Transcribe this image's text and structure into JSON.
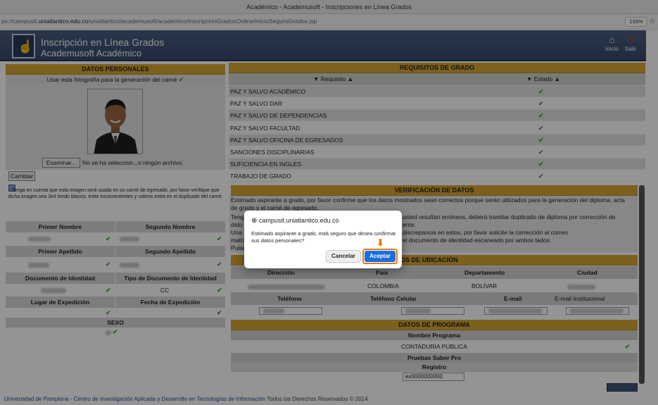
{
  "browser": {
    "window_title": "Académico - Academusoft - Inscripciones en Línea Grados",
    "url_prefix": "ps://campusit.",
    "url_domain": "uniatlantico.edu.co",
    "url_path": "/uniatlantico/academusoft/academico/inscripcionGradosOnline/inicioSeguroGrados.jsp",
    "zoom": "133%"
  },
  "header": {
    "title": "Inscripción en Línea Grados",
    "subtitle": "Academusoft Académico",
    "nav_home": "Inicio",
    "nav_exit": "Salir"
  },
  "personal": {
    "section_title": "DATOS PERSONALES",
    "photo_note": "Usar esta fotografía para la generación del carné",
    "browse_label": "Examinar...",
    "file_status": "No se ha seleccion...o ningún archivo.",
    "change_label": "Cambiar",
    "notice": "Tenga en cuenta que esta imagen será usada en su carné de egresado, por favor verifique que dicha imagen sea 3x4 fondo blanco, evite inconvenientes y cobros extra en el duplicado del carné.",
    "first_name_label": "Primer Nombre",
    "second_name_label": "Segundo Nombre",
    "first_surname_label": "Primer Apellido",
    "second_surname_label": "Segundo Apellido",
    "id_label": "Documento de Identidad",
    "id_type_label": "Tipo de Documento de Identidad",
    "id_type_value": "CC",
    "issue_place_label": "Lugar de Expedición",
    "issue_date_label": "Fecha de Expedición",
    "sex_label": "SEXO"
  },
  "requirements": {
    "section_title": "REQUISITOS DE GRADO",
    "col_requirement": "▼ Requisito ▲",
    "col_status": "▼ Estado ▲",
    "items": [
      "PAZ Y SALVO ACADÉMICO",
      "PAZ Y SALVO DAR",
      "PAZ Y SALVO DE DEPENDENCIAS",
      "PAZ Y SALVO FACULTAD",
      "PAZ Y SALVO OFICINA DE EGRESADOS",
      "SANCIONES DISCIPLINARIAS",
      "SUFICIENCIA EN INGLES",
      "TRABAJO DE GRADO"
    ]
  },
  "verification": {
    "section_title": "VERIFICACIÓN DE DATOS",
    "line1": "Estimado aspirante a grado, por favor confirme que los datos mostrados sean correctos porque serán utilizados para la generación del diploma, acta",
    "line2a": "de g",
    "line2b": "rado y el carné de egresado.",
    "line3a": "Teng",
    "line3b": "usted resultan erróneos, deberá tramitar duplicado de diploma por corrección de",
    "line4a": "dato",
    "line4b": "ente.",
    "line5a": "Una",
    "line5b": "discrepancia en estos, por favor solicite la corrección al correo",
    "line6a": "matri",
    "line6b": "el documento de identidad escaneado por ambos lados.",
    "line7a": "Pulse"
  },
  "location": {
    "section_title": "DATOS DE UBICACIÓN",
    "section_title_visible": "ATOS DE UBICACIÓN",
    "address_label": "Dirección",
    "country_label": "País",
    "department_label": "Departamento",
    "city_label": "Ciudad",
    "country_value": "COLOMBIA",
    "department_value": "BOLÍVAR",
    "phone_label": "Teléfono",
    "mobile_label": "Teléfono Celular",
    "email_label": "E-mail",
    "inst_email_label": "E-mail Institucional"
  },
  "program": {
    "section_title": "DATOS DE PROGRAMA",
    "program_name_label": "Nombre Programa",
    "program_name_value": "CONTADURIA PUBLICA",
    "saber_pro_label": "Pruebas Saber Pro",
    "registry_label": "Registro",
    "registry_value": "ex0000000000"
  },
  "dialog": {
    "origin": "campusit.uniatlantico.edu.co",
    "message": "Estimado aspirante a grado, está seguro que desea confirmar sus datos personales?",
    "cancel_label": "Cancelar",
    "accept_label": "Aceptar"
  },
  "footer": {
    "text": "Universidad de Pamplona - Centro de Investigación Aplicada y Desarrollo en Tecnologías de Información",
    "rights": " Todos los Derechos Reservados © 2014"
  },
  "colors": {
    "section_gold": "#d8a632",
    "header_blue": "#3f5375",
    "check_green": "#3aa22c",
    "accept_blue": "#1a6fe0",
    "highlight_orange": "#e07b12"
  }
}
